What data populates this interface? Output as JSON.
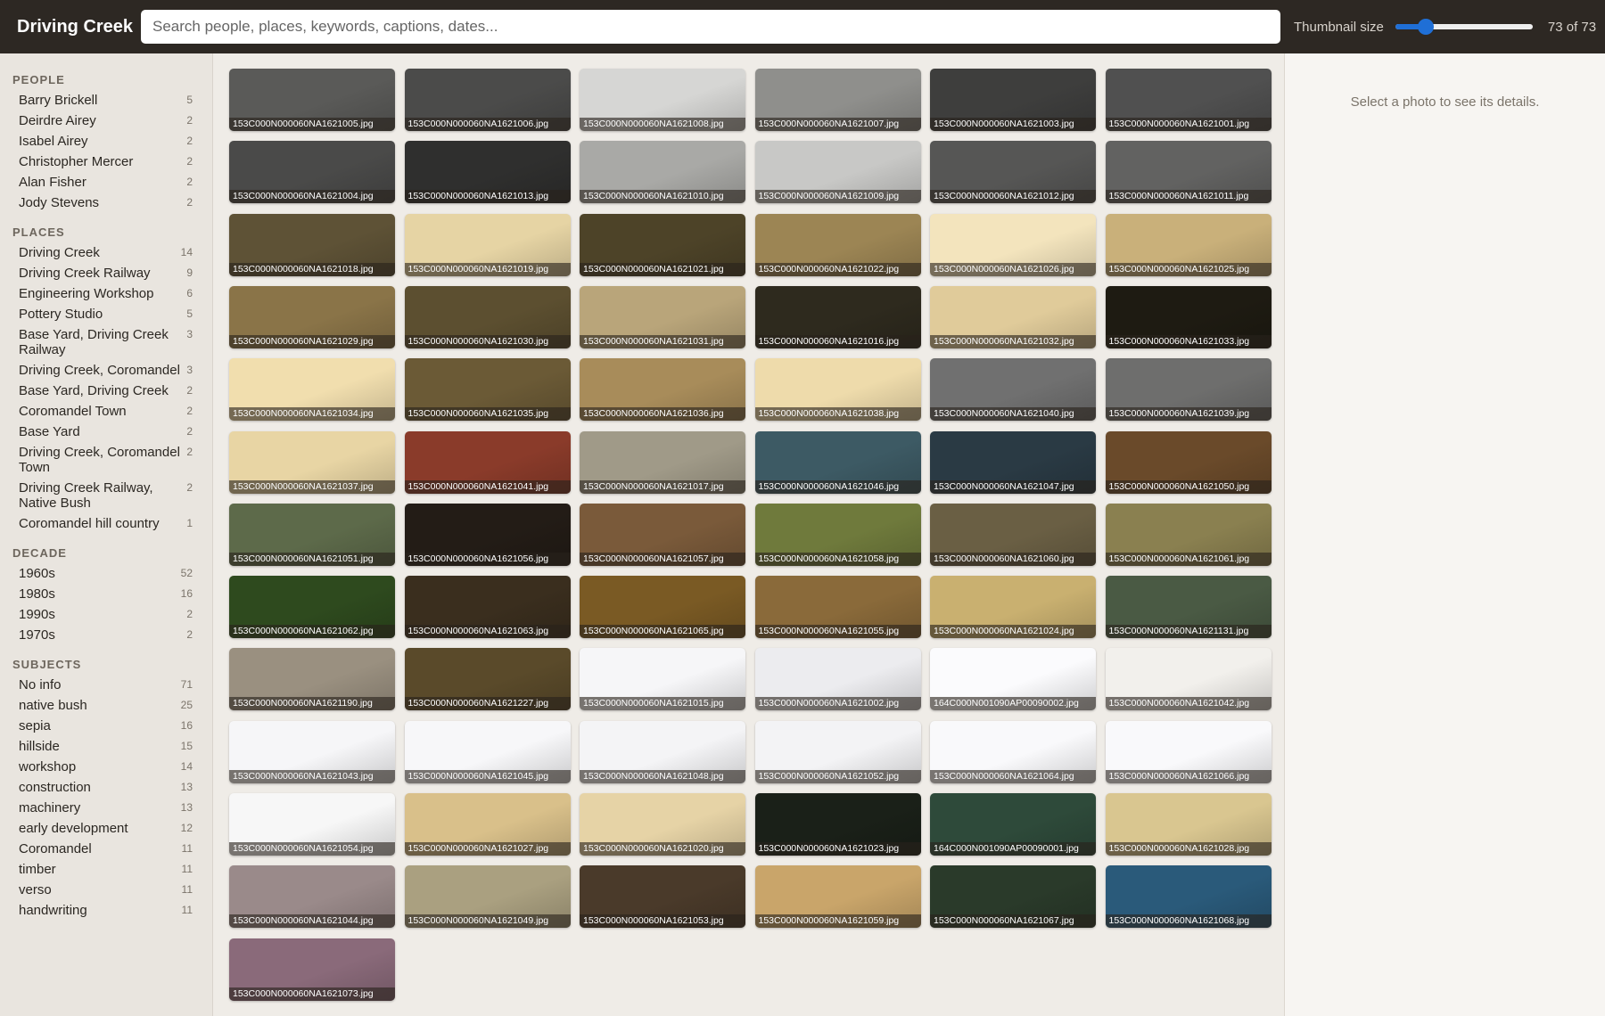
{
  "header": {
    "title": "Driving Creek",
    "search_placeholder": "Search people, places, keywords, captions, dates...",
    "thumb_size_label": "Thumbnail size",
    "thumb_size_level": 0.22,
    "count": "73 of 73"
  },
  "sidebar": {
    "sections": [
      {
        "title": "PEOPLE",
        "items": [
          {
            "label": "Barry Brickell",
            "count": "5"
          },
          {
            "label": "Deirdre Airey",
            "count": "2"
          },
          {
            "label": "Isabel Airey",
            "count": "2"
          },
          {
            "label": "Christopher Mercer",
            "count": "2"
          },
          {
            "label": "Alan Fisher",
            "count": "2"
          },
          {
            "label": "Jody Stevens",
            "count": "2"
          }
        ]
      },
      {
        "title": "PLACES",
        "items": [
          {
            "label": "Driving Creek",
            "count": "14"
          },
          {
            "label": "Driving Creek Railway",
            "count": "9"
          },
          {
            "label": "Engineering Workshop",
            "count": "6"
          },
          {
            "label": "Pottery Studio",
            "count": "5"
          },
          {
            "label": "Base Yard, Driving Creek Railway",
            "count": "3"
          },
          {
            "label": "Driving Creek, Coromandel",
            "count": "3"
          },
          {
            "label": "Base Yard, Driving Creek",
            "count": "2"
          },
          {
            "label": "Coromandel Town",
            "count": "2"
          },
          {
            "label": "Base Yard",
            "count": "2"
          },
          {
            "label": "Driving Creek, Coromandel Town",
            "count": "2"
          },
          {
            "label": "Driving Creek Railway, Native Bush",
            "count": "2"
          },
          {
            "label": "Coromandel hill country",
            "count": "1"
          }
        ]
      },
      {
        "title": "DECADE",
        "items": [
          {
            "label": "1960s",
            "count": "52"
          },
          {
            "label": "1980s",
            "count": "16"
          },
          {
            "label": "1990s",
            "count": "2"
          },
          {
            "label": "1970s",
            "count": "2"
          }
        ]
      },
      {
        "title": "SUBJECTS",
        "items": [
          {
            "label": "No info",
            "count": "71"
          },
          {
            "label": "native bush",
            "count": "25"
          },
          {
            "label": "sepia",
            "count": "16"
          },
          {
            "label": "hillside",
            "count": "15"
          },
          {
            "label": "workshop",
            "count": "14"
          },
          {
            "label": "construction",
            "count": "13"
          },
          {
            "label": "machinery",
            "count": "13"
          },
          {
            "label": "early development",
            "count": "12"
          },
          {
            "label": "Coromandel",
            "count": "11"
          },
          {
            "label": "timber",
            "count": "11"
          },
          {
            "label": "verso",
            "count": "11"
          },
          {
            "label": "handwriting",
            "count": "11"
          }
        ]
      }
    ]
  },
  "photos": [
    {
      "file": "153C000N000060NA1621005.jpg",
      "tone": "#5a5a58"
    },
    {
      "file": "153C000N000060NA1621006.jpg",
      "tone": "#4b4b4a"
    },
    {
      "file": "153C000N000060NA1621008.jpg",
      "tone": "#d6d6d4"
    },
    {
      "file": "153C000N000060NA1621007.jpg",
      "tone": "#8f8f8c"
    },
    {
      "file": "153C000N000060NA1621003.jpg",
      "tone": "#3e3e3d"
    },
    {
      "file": "153C000N000060NA1621001.jpg",
      "tone": "#505050"
    },
    {
      "file": "153C000N000060NA1621004.jpg",
      "tone": "#4a4a49"
    },
    {
      "file": "153C000N000060NA1621013.jpg",
      "tone": "#2f2f2e"
    },
    {
      "file": "153C000N000060NA1621010.jpg",
      "tone": "#a9a9a6"
    },
    {
      "file": "153C000N000060NA1621009.jpg",
      "tone": "#c8c8c6"
    },
    {
      "file": "153C000N000060NA1621012.jpg",
      "tone": "#565655"
    },
    {
      "file": "153C000N000060NA1621011.jpg",
      "tone": "#626261"
    },
    {
      "file": "153C000N000060NA1621018.jpg",
      "tone": "#5e5236"
    },
    {
      "file": "153C000N000060NA1621019.jpg",
      "tone": "#e6d4a4"
    },
    {
      "file": "153C000N000060NA1621021.jpg",
      "tone": "#4d4328"
    },
    {
      "file": "153C000N000060NA1621022.jpg",
      "tone": "#9c8554"
    },
    {
      "file": "153C000N000060NA1621026.jpg",
      "tone": "#f3e4bd"
    },
    {
      "file": "153C000N000060NA1621025.jpg",
      "tone": "#c9b07a"
    },
    {
      "file": "153C000N000060NA1621029.jpg",
      "tone": "#8a7448"
    },
    {
      "file": "153C000N000060NA1621030.jpg",
      "tone": "#5c4f30"
    },
    {
      "file": "153C000N000060NA1621031.jpg",
      "tone": "#b9a57a"
    },
    {
      "file": "153C000N000060NA1621016.jpg",
      "tone": "#2e2a1e"
    },
    {
      "file": "153C000N000060NA1621032.jpg",
      "tone": "#e0cb9a"
    },
    {
      "file": "153C000N000060NA1621033.jpg",
      "tone": "#1e1b12"
    },
    {
      "file": "153C000N000060NA1621034.jpg",
      "tone": "#f1deae"
    },
    {
      "file": "153C000N000060NA1621035.jpg",
      "tone": "#6b5a36"
    },
    {
      "file": "153C000N000060NA1621036.jpg",
      "tone": "#a88c5a"
    },
    {
      "file": "153C000N000060NA1621038.jpg",
      "tone": "#eedbab"
    },
    {
      "file": "153C000N000060NA1621040.jpg",
      "tone": "#707070"
    },
    {
      "file": "153C000N000060NA1621039.jpg",
      "tone": "#6e6e6d"
    },
    {
      "file": "153C000N000060NA1621037.jpg",
      "tone": "#e8d5a4"
    },
    {
      "file": "153C000N000060NA1621041.jpg",
      "tone": "#8a3b2a"
    },
    {
      "file": "153C000N000060NA1621017.jpg",
      "tone": "#a09a88"
    },
    {
      "file": "153C000N000060NA1621046.jpg",
      "tone": "#3d5a64"
    },
    {
      "file": "153C000N000060NA1621047.jpg",
      "tone": "#2a3a44"
    },
    {
      "file": "153C000N000060NA1621050.jpg",
      "tone": "#6a4a2a"
    },
    {
      "file": "153C000N000060NA1621051.jpg",
      "tone": "#5d6a4a"
    },
    {
      "file": "153C000N000060NA1621056.jpg",
      "tone": "#231c16"
    },
    {
      "file": "153C000N000060NA1621057.jpg",
      "tone": "#7a5a3a"
    },
    {
      "file": "153C000N000060NA1621058.jpg",
      "tone": "#6f7a3c"
    },
    {
      "file": "153C000N000060NA1621060.jpg",
      "tone": "#6a5f44"
    },
    {
      "file": "153C000N000060NA1621061.jpg",
      "tone": "#8a8050"
    },
    {
      "file": "153C000N000060NA1621062.jpg",
      "tone": "#2e4a1e"
    },
    {
      "file": "153C000N000060NA1621063.jpg",
      "tone": "#3a2e1e"
    },
    {
      "file": "153C000N000060NA1621065.jpg",
      "tone": "#7a5a24"
    },
    {
      "file": "153C000N000060NA1621055.jpg",
      "tone": "#8a6a3a"
    },
    {
      "file": "153C000N000060NA1621024.jpg",
      "tone": "#c9b070"
    },
    {
      "file": "153C000N000060NA1621131.jpg",
      "tone": "#4a5a44"
    },
    {
      "file": "153C000N000060NA1621190.jpg",
      "tone": "#9a9080"
    },
    {
      "file": "153C000N000060NA1621227.jpg",
      "tone": "#5a4a2a"
    },
    {
      "file": "153C000N000060NA1621015.jpg",
      "tone": "#f6f6f8"
    },
    {
      "file": "153C000N000060NA1621002.jpg",
      "tone": "#ececef"
    },
    {
      "file": "164C000N001090AP00090002.jpg",
      "tone": "#fbfbfd"
    },
    {
      "file": "153C000N000060NA1621042.jpg",
      "tone": "#f2f0ec"
    },
    {
      "file": "153C000N000060NA1621043.jpg",
      "tone": "#f6f6f8"
    },
    {
      "file": "153C000N000060NA1621045.jpg",
      "tone": "#f7f7f9"
    },
    {
      "file": "153C000N000060NA1621048.jpg",
      "tone": "#f4f4f6"
    },
    {
      "file": "153C000N000060NA1621052.jpg",
      "tone": "#f3f3f5"
    },
    {
      "file": "153C000N000060NA1621064.jpg",
      "tone": "#f9f9fb"
    },
    {
      "file": "153C000N000060NA1621066.jpg",
      "tone": "#f9f9fb"
    },
    {
      "file": "153C000N000060NA1621054.jpg",
      "tone": "#f7f7f7"
    },
    {
      "file": "153C000N000060NA1621027.jpg",
      "tone": "#d9c08a"
    },
    {
      "file": "153C000N000060NA1621020.jpg",
      "tone": "#e6d3a6"
    },
    {
      "file": "153C000N000060NA1621023.jpg",
      "tone": "#1a2018"
    },
    {
      "file": "164C000N001090AP00090001.jpg",
      "tone": "#2e4a3a"
    },
    {
      "file": "153C000N000060NA1621028.jpg",
      "tone": "#d9c690"
    },
    {
      "file": "153C000N000060NA1621044.jpg",
      "tone": "#9a8a8a"
    },
    {
      "file": "153C000N000060NA1621049.jpg",
      "tone": "#aaa080"
    },
    {
      "file": "153C000N000060NA1621053.jpg",
      "tone": "#4a3a2a"
    },
    {
      "file": "153C000N000060NA1621059.jpg",
      "tone": "#c9a56a"
    },
    {
      "file": "153C000N000060NA1621067.jpg",
      "tone": "#2a3a2a"
    },
    {
      "file": "153C000N000060NA1621068.jpg",
      "tone": "#2a5a7a"
    },
    {
      "file": "153C000N000060NA1621073.jpg",
      "tone": "#8a6a7a"
    }
  ],
  "details": {
    "empty_message": "Select a photo to see its details."
  }
}
